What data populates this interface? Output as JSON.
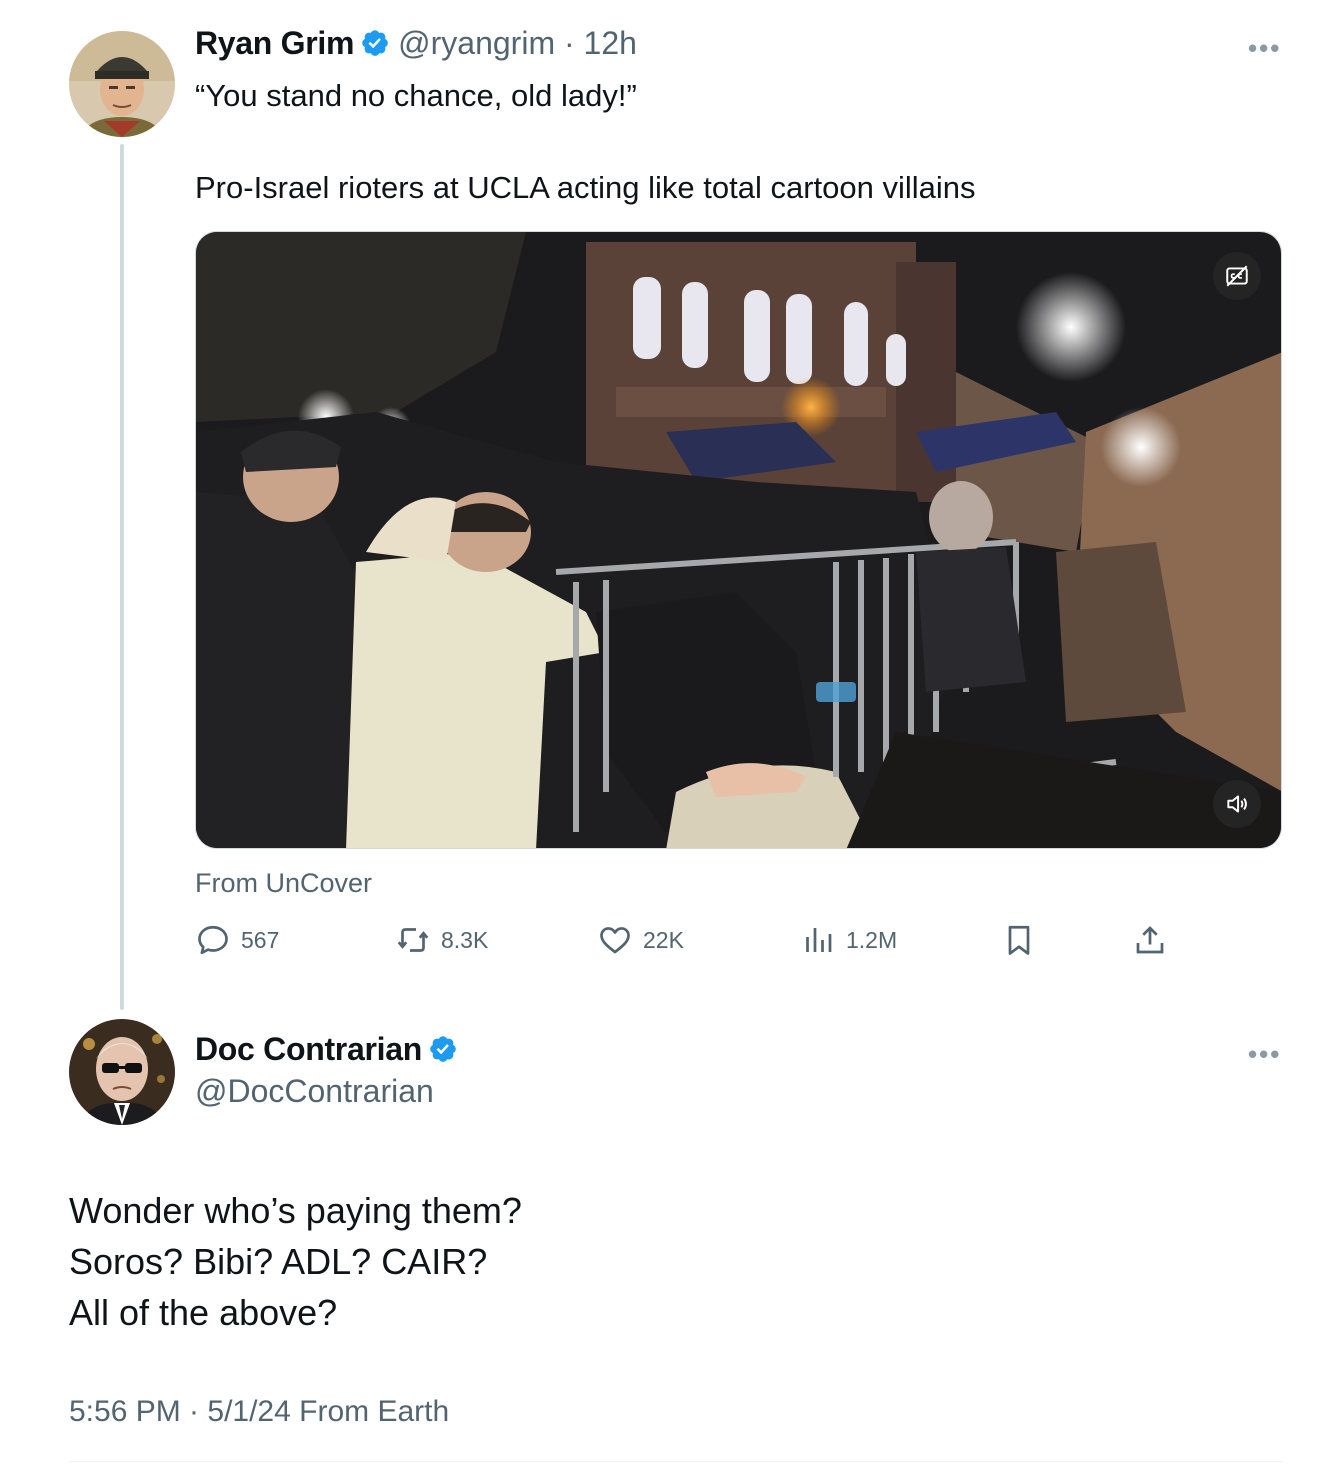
{
  "tweet": {
    "author_name": "Ryan Grim",
    "author_handle": "@ryangrim",
    "time_sep": " · ",
    "time": "12h",
    "text_line1": "“You stand no chance, old lady!”",
    "text_line2": "Pro-Israel rioters at UCLA acting like total cartoon villains",
    "more_label": "•••",
    "source_label": "From UnCover",
    "actions": {
      "replies": "567",
      "reposts": "8.3K",
      "likes": "22K",
      "views": "1.2M"
    },
    "icons": {
      "reply": "reply-icon",
      "repost": "repost-icon",
      "like": "heart-icon",
      "views": "views-icon",
      "bookmark": "bookmark-icon",
      "share": "share-icon",
      "captions": "captions-icon",
      "volume": "volume-icon",
      "verified": "verified-badge-icon"
    }
  },
  "reply": {
    "author_name": "Doc Contrarian",
    "author_handle": "@DocContrarian",
    "more_label": "•••",
    "lines": [
      "Wonder who’s paying them?",
      "Soros? Bibi? ADL? CAIR?",
      "All of the above?"
    ],
    "timestamp": "5:56 PM · 5/1/24 From Earth"
  },
  "colors": {
    "verified_blue": "#1d9bf0",
    "secondary_text": "#536471",
    "primary_text": "#0f1419",
    "thread_line": "#cfd9de"
  }
}
